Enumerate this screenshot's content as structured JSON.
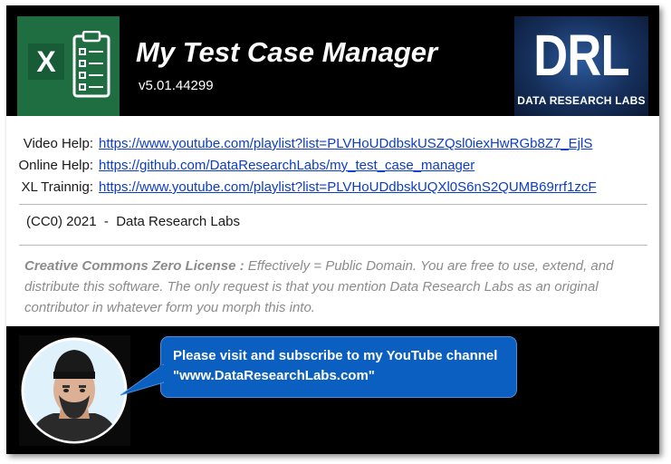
{
  "header": {
    "title": "My Test Case Manager",
    "version": "v5.01.44299",
    "excel_logo_letter": "X",
    "drl_logo_letters": "DRL",
    "drl_logo_name": "DATA RESEARCH LABS",
    "brand_colors": {
      "excel_green": "#1e6e42",
      "drl_blue": "#16305c"
    }
  },
  "links": [
    {
      "label": "Video Help:",
      "url": "https://www.youtube.com/playlist?list=PLVHoUDdbskUSZQsl0iexHwRGb8Z7_EjlS"
    },
    {
      "label": "Online Help:",
      "url": "https://github.com/DataResearchLabs/my_test_case_manager"
    },
    {
      "label": "XL Trainnig:",
      "url": "https://www.youtube.com/playlist?list=PLVHoUDdbskUQXl0S6nS2QUMB69rrf1zcF"
    }
  ],
  "copyright": "(CC0) 2021  -  Data Research Labs",
  "license": {
    "heading": "Creative Commons Zero License :",
    "body": "  Effectively = Public Domain.  You are free to use, extend, and distribute this software.  The only request is that you mention Data Research Labs as an original contributor in whatever form you morph this into."
  },
  "footer": {
    "callout_text": "Please visit and subscribe to my YouTube channel \"www.DataResearchLabs.com\"",
    "callout_color": "#0b5fc0",
    "avatar_icon": "author-avatar-icon"
  }
}
